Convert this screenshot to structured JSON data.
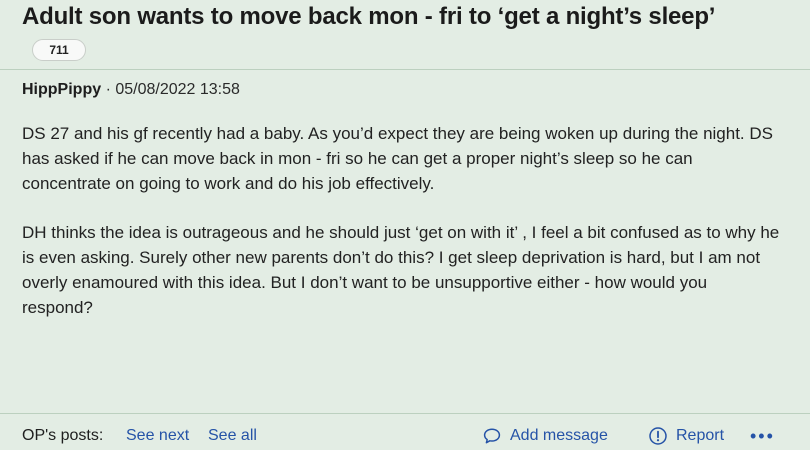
{
  "thread": {
    "title": "Adult son wants to move back mon - fri to ‘get a night’s sleep’",
    "reply_count": "711"
  },
  "post": {
    "author": "HippPippy",
    "separator": "·",
    "timestamp": "05/08/2022 13:58",
    "paragraphs": [
      "DS 27 and his gf recently had a baby. As you’d expect they are being woken up during the night. DS has asked if he can move back in mon - fri so he can get a proper night’s sleep so he can concentrate on going to work and do his job effectively.",
      "DH thinks the idea is outrageous and he should just ‘get on with it’ , I feel a bit confused as to why he is even asking. Surely other new parents don’t do this? I get sleep deprivation is hard, but I am not overly enamoured with this idea. But I don’t want to be unsupportive either - how would you respond?"
    ]
  },
  "footer": {
    "ops_posts_label": "OP's posts:",
    "see_next_label": "See next",
    "see_all_label": "See all",
    "add_message_label": "Add message",
    "add_message_icon": "speech-bubble-icon",
    "report_label": "Report",
    "report_icon": "alert-circle-icon",
    "more_label": "•••"
  },
  "colors": {
    "background": "#e3ede4",
    "link": "#2553a7",
    "divider": "#bcd0bf"
  }
}
